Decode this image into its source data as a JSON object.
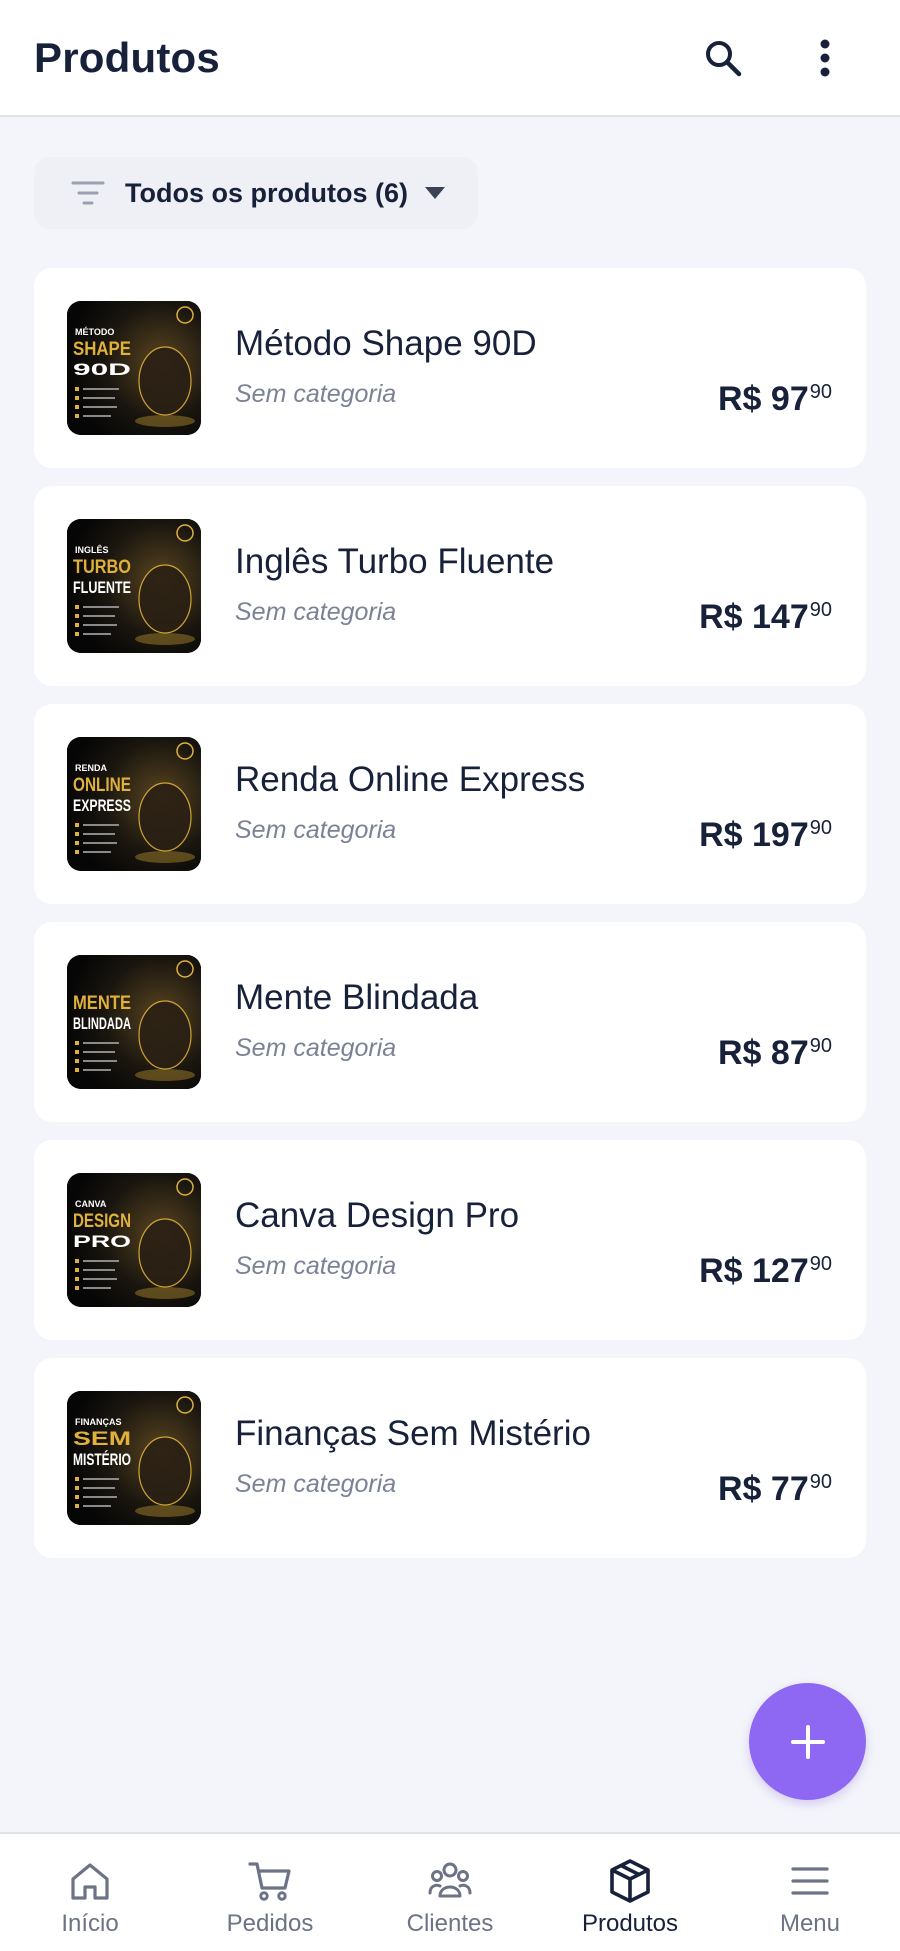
{
  "header": {
    "title": "Produtos"
  },
  "filter": {
    "label": "Todos os produtos (6)"
  },
  "products": [
    {
      "name": "Método Shape 90D",
      "category": "Sem categoria",
      "currency": "R$",
      "price_int": "97",
      "price_cents": "90",
      "thumb": {
        "line1": "MÉTODO",
        "line2": "SHAPE",
        "line3": "90D"
      }
    },
    {
      "name": "Inglês Turbo Fluente",
      "category": "Sem categoria",
      "currency": "R$",
      "price_int": "147",
      "price_cents": "90",
      "thumb": {
        "line1": "INGLÊS",
        "line2": "TURBO",
        "line3": "FLUENTE"
      }
    },
    {
      "name": "Renda Online Express",
      "category": "Sem categoria",
      "currency": "R$",
      "price_int": "197",
      "price_cents": "90",
      "thumb": {
        "line1": "RENDA",
        "line2": "ONLINE",
        "line3": "EXPRESS"
      }
    },
    {
      "name": "Mente Blindada",
      "category": "Sem categoria",
      "currency": "R$",
      "price_int": "87",
      "price_cents": "90",
      "thumb": {
        "line1": "",
        "line2": "MENTE",
        "line3": "BLINDADA"
      }
    },
    {
      "name": "Canva Design Pro",
      "category": "Sem categoria",
      "currency": "R$",
      "price_int": "127",
      "price_cents": "90",
      "thumb": {
        "line1": "CANVA",
        "line2": "DESIGN",
        "line3": "PRO"
      }
    },
    {
      "name": "Finanças Sem Mistério",
      "category": "Sem categoria",
      "currency": "R$",
      "price_int": "77",
      "price_cents": "90",
      "thumb": {
        "line1": "FINANÇAS",
        "line2": "SEM",
        "line3": "MISTÉRIO"
      }
    }
  ],
  "nav": [
    {
      "label": "Início",
      "icon": "home-icon"
    },
    {
      "label": "Pedidos",
      "icon": "cart-icon"
    },
    {
      "label": "Clientes",
      "icon": "users-icon"
    },
    {
      "label": "Produtos",
      "icon": "box-icon",
      "active": true
    },
    {
      "label": "Menu",
      "icon": "menu-icon"
    }
  ],
  "colors": {
    "accent": "#8e67f2",
    "text": "#17213a",
    "muted": "#7b8296",
    "gold": "#e0b13a"
  }
}
